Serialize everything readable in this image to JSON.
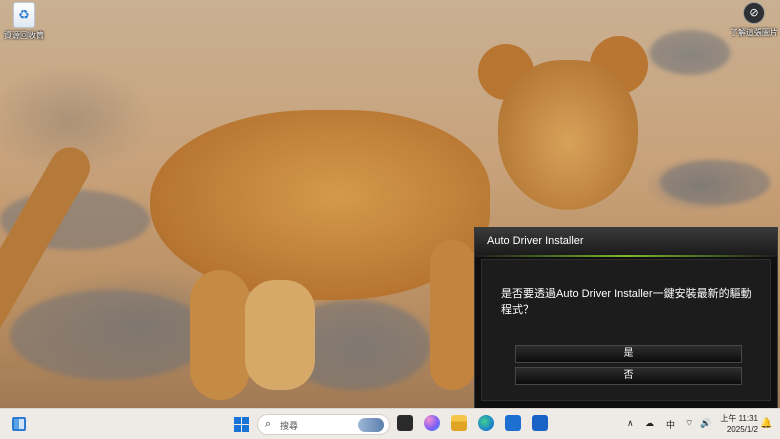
{
  "desktop": {
    "icon_label": "資源回收筒",
    "top_right_label": "了解這張圖片"
  },
  "dialog": {
    "title": "Auto Driver Installer",
    "message": "是否要透過Auto Driver Installer一鍵安裝最新的驅動程式？",
    "yes_label": "是",
    "no_label": "否",
    "accent_color": "#7dbb2a"
  },
  "taskbar": {
    "search_placeholder": "搜尋",
    "ime": "中",
    "time": "上午 11:31",
    "date": "2025/1/2",
    "icons": [
      "widgets-icon",
      "windows-start-icon",
      "search-icon",
      "task-view-icon",
      "copilot-icon",
      "file-explorer-icon",
      "edge-icon",
      "store-icon",
      "outlook-icon",
      "chevron-up-icon",
      "cloud-icon",
      "wifi-icon",
      "speaker-icon",
      "bell-icon"
    ]
  }
}
